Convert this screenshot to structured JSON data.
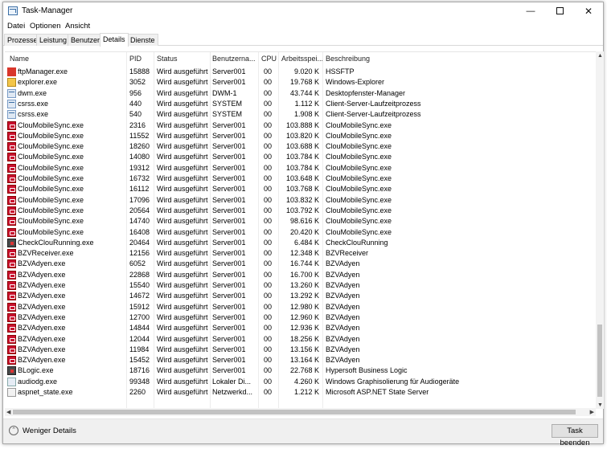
{
  "window": {
    "title": "Task-Manager",
    "minimize_glyph": "—",
    "close_glyph": "✕"
  },
  "menu": [
    "Datei",
    "Optionen",
    "Ansicht"
  ],
  "tabs": [
    {
      "label": "Prozesse",
      "active": false
    },
    {
      "label": "Leistung",
      "active": false
    },
    {
      "label": "Benutzer",
      "active": false
    },
    {
      "label": "Details",
      "active": true
    },
    {
      "label": "Dienste",
      "active": false
    }
  ],
  "columns": {
    "name": "Name",
    "pid": "PID",
    "status": "Status",
    "user": "Benutzerna...",
    "cpu": "CPU",
    "mem": "Arbeitsspei...",
    "desc": "Beschreibung"
  },
  "sort_glyph": "^",
  "processes": [
    {
      "name": "ftpManager.exe",
      "pid": "15888",
      "status": "Wird ausgeführt",
      "user": "Server001",
      "cpu": "00",
      "mem": "9.020 K",
      "desc": "HSSFTP",
      "icon": "ftp-icon"
    },
    {
      "name": "explorer.exe",
      "pid": "3052",
      "status": "Wird ausgeführt",
      "user": "Server001",
      "cpu": "00",
      "mem": "19.768 K",
      "desc": "Windows-Explorer",
      "icon": "folder-icon"
    },
    {
      "name": "dwm.exe",
      "pid": "956",
      "status": "Wird ausgeführt",
      "user": "DWM-1",
      "cpu": "00",
      "mem": "43.744 K",
      "desc": "Desktopfenster-Manager",
      "icon": "window-icon"
    },
    {
      "name": "csrss.exe",
      "pid": "440",
      "status": "Wird ausgeführt",
      "user": "SYSTEM",
      "cpu": "00",
      "mem": "1.112 K",
      "desc": "Client-Server-Laufzeitprozess",
      "icon": "window-icon"
    },
    {
      "name": "csrss.exe",
      "pid": "540",
      "status": "Wird ausgeführt",
      "user": "SYSTEM",
      "cpu": "00",
      "mem": "1.908 K",
      "desc": "Client-Server-Laufzeitprozess",
      "icon": "window-icon"
    },
    {
      "name": "ClouMobileSync.exe",
      "pid": "2316",
      "status": "Wird ausgeführt",
      "user": "Server001",
      "cpu": "00",
      "mem": "103.888 K",
      "desc": "ClouMobileSync.exe",
      "icon": "clou-icon"
    },
    {
      "name": "ClouMobileSync.exe",
      "pid": "11552",
      "status": "Wird ausgeführt",
      "user": "Server001",
      "cpu": "00",
      "mem": "103.820 K",
      "desc": "ClouMobileSync.exe",
      "icon": "clou-icon"
    },
    {
      "name": "ClouMobileSync.exe",
      "pid": "18260",
      "status": "Wird ausgeführt",
      "user": "Server001",
      "cpu": "00",
      "mem": "103.688 K",
      "desc": "ClouMobileSync.exe",
      "icon": "clou-icon"
    },
    {
      "name": "ClouMobileSync.exe",
      "pid": "14080",
      "status": "Wird ausgeführt",
      "user": "Server001",
      "cpu": "00",
      "mem": "103.784 K",
      "desc": "ClouMobileSync.exe",
      "icon": "clou-icon"
    },
    {
      "name": "ClouMobileSync.exe",
      "pid": "19312",
      "status": "Wird ausgeführt",
      "user": "Server001",
      "cpu": "00",
      "mem": "103.784 K",
      "desc": "ClouMobileSync.exe",
      "icon": "clou-icon"
    },
    {
      "name": "ClouMobileSync.exe",
      "pid": "16732",
      "status": "Wird ausgeführt",
      "user": "Server001",
      "cpu": "00",
      "mem": "103.648 K",
      "desc": "ClouMobileSync.exe",
      "icon": "clou-icon"
    },
    {
      "name": "ClouMobileSync.exe",
      "pid": "16112",
      "status": "Wird ausgeführt",
      "user": "Server001",
      "cpu": "00",
      "mem": "103.768 K",
      "desc": "ClouMobileSync.exe",
      "icon": "clou-icon"
    },
    {
      "name": "ClouMobileSync.exe",
      "pid": "17096",
      "status": "Wird ausgeführt",
      "user": "Server001",
      "cpu": "00",
      "mem": "103.832 K",
      "desc": "ClouMobileSync.exe",
      "icon": "clou-icon"
    },
    {
      "name": "ClouMobileSync.exe",
      "pid": "20564",
      "status": "Wird ausgeführt",
      "user": "Server001",
      "cpu": "00",
      "mem": "103.792 K",
      "desc": "ClouMobileSync.exe",
      "icon": "clou-icon"
    },
    {
      "name": "ClouMobileSync.exe",
      "pid": "14740",
      "status": "Wird ausgeführt",
      "user": "Server001",
      "cpu": "00",
      "mem": "98.616 K",
      "desc": "ClouMobileSync.exe",
      "icon": "clou-icon"
    },
    {
      "name": "ClouMobileSync.exe",
      "pid": "16408",
      "status": "Wird ausgeführt",
      "user": "Server001",
      "cpu": "00",
      "mem": "20.420 K",
      "desc": "ClouMobileSync.exe",
      "icon": "clou-icon"
    },
    {
      "name": "CheckClouRunning.exe",
      "pid": "20464",
      "status": "Wird ausgeführt",
      "user": "Server001",
      "cpu": "00",
      "mem": "6.484 K",
      "desc": "CheckClouRunning",
      "icon": "check-icon"
    },
    {
      "name": "BZVReceiver.exe",
      "pid": "12156",
      "status": "Wird ausgeführt",
      "user": "Server001",
      "cpu": "00",
      "mem": "12.348 K",
      "desc": "BZVReceiver",
      "icon": "clou-icon"
    },
    {
      "name": "BZVAdyen.exe",
      "pid": "6052",
      "status": "Wird ausgeführt",
      "user": "Server001",
      "cpu": "00",
      "mem": "16.744 K",
      "desc": "BZVAdyen",
      "icon": "clou-icon"
    },
    {
      "name": "BZVAdyen.exe",
      "pid": "22868",
      "status": "Wird ausgeführt",
      "user": "Server001",
      "cpu": "00",
      "mem": "16.700 K",
      "desc": "BZVAdyen",
      "icon": "clou-icon"
    },
    {
      "name": "BZVAdyen.exe",
      "pid": "15540",
      "status": "Wird ausgeführt",
      "user": "Server001",
      "cpu": "00",
      "mem": "13.260 K",
      "desc": "BZVAdyen",
      "icon": "clou-icon"
    },
    {
      "name": "BZVAdyen.exe",
      "pid": "14672",
      "status": "Wird ausgeführt",
      "user": "Server001",
      "cpu": "00",
      "mem": "13.292 K",
      "desc": "BZVAdyen",
      "icon": "clou-icon"
    },
    {
      "name": "BZVAdyen.exe",
      "pid": "15912",
      "status": "Wird ausgeführt",
      "user": "Server001",
      "cpu": "00",
      "mem": "12.980 K",
      "desc": "BZVAdyen",
      "icon": "clou-icon"
    },
    {
      "name": "BZVAdyen.exe",
      "pid": "12700",
      "status": "Wird ausgeführt",
      "user": "Server001",
      "cpu": "00",
      "mem": "12.960 K",
      "desc": "BZVAdyen",
      "icon": "clou-icon"
    },
    {
      "name": "BZVAdyen.exe",
      "pid": "14844",
      "status": "Wird ausgeführt",
      "user": "Server001",
      "cpu": "00",
      "mem": "12.936 K",
      "desc": "BZVAdyen",
      "icon": "clou-icon"
    },
    {
      "name": "BZVAdyen.exe",
      "pid": "12044",
      "status": "Wird ausgeführt",
      "user": "Server001",
      "cpu": "00",
      "mem": "18.256 K",
      "desc": "BZVAdyen",
      "icon": "clou-icon"
    },
    {
      "name": "BZVAdyen.exe",
      "pid": "11984",
      "status": "Wird ausgeführt",
      "user": "Server001",
      "cpu": "00",
      "mem": "13.156 K",
      "desc": "BZVAdyen",
      "icon": "clou-icon"
    },
    {
      "name": "BZVAdyen.exe",
      "pid": "15452",
      "status": "Wird ausgeführt",
      "user": "Server001",
      "cpu": "00",
      "mem": "13.164 K",
      "desc": "BZVAdyen",
      "icon": "clou-icon"
    },
    {
      "name": "BLogic.exe",
      "pid": "18716",
      "status": "Wird ausgeführt",
      "user": "Server001",
      "cpu": "00",
      "mem": "22.768 K",
      "desc": "Hypersoft Business Logic",
      "icon": "check-icon"
    },
    {
      "name": "audiodg.exe",
      "pid": "99348",
      "status": "Wird ausgeführt",
      "user": "Lokaler Di...",
      "cpu": "00",
      "mem": "4.260 K",
      "desc": "Windows Graphisolierung für Audiogeräte",
      "icon": "speaker-icon"
    },
    {
      "name": "aspnet_state.exe",
      "pid": "2260",
      "status": "Wird ausgeführt",
      "user": "Netzwerkd...",
      "cpu": "00",
      "mem": "1.212 K",
      "desc": "Microsoft ASP.NET State Server",
      "icon": "aspnet-icon"
    }
  ],
  "footer": {
    "fewer_details": "Weniger Details",
    "end_task": "Task beenden"
  }
}
